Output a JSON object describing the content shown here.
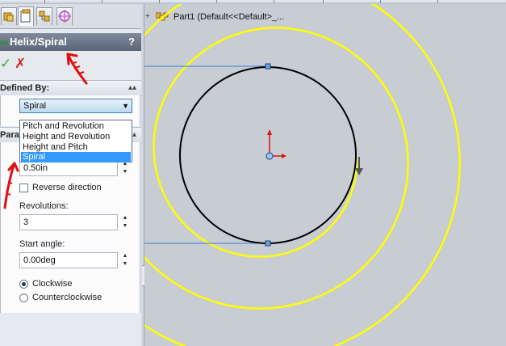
{
  "property_manager": {
    "title": "Helix/Spiral",
    "help_glyph": "?",
    "ok_glyph": "✓",
    "cancel_glyph": "✗",
    "defined_by": {
      "header": "Defined By:",
      "selected": "Spiral",
      "options": [
        "Pitch and Revolution",
        "Height and Revolution",
        "Height and Pitch",
        "Spiral"
      ]
    },
    "parameters": {
      "header": "Param",
      "pitch_value": "0.50in",
      "reverse_direction_label": "Reverse direction",
      "revolutions_label": "Revolutions:",
      "revolutions_value": "3",
      "start_angle_label": "Start angle:",
      "start_angle_value": "0.00deg",
      "clockwise_label": "Clockwise",
      "counterclockwise_label": "Counterclockwise",
      "direction": "Clockwise"
    }
  },
  "feature_tree": {
    "expander": "+",
    "part_label": "Part1  (Default<<Default>_..."
  },
  "colors": {
    "spiral": "#ffff00",
    "circle": "#000000",
    "annotation": "#e01010",
    "title_bar": "#5a6678"
  },
  "icons": {
    "helix": "helix-icon",
    "ok": "check-icon",
    "cancel": "x-icon",
    "collapse": "chevron-up-double-icon"
  }
}
